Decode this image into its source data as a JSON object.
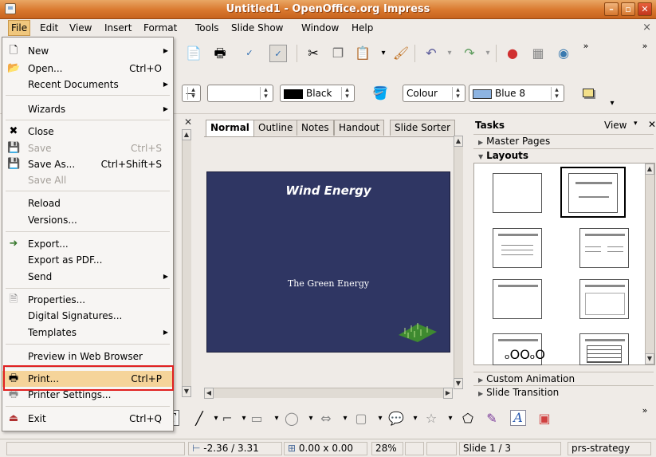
{
  "window": {
    "title": "Untitled1 - OpenOffice.org Impress"
  },
  "menubar": {
    "items": [
      "File",
      "Edit",
      "View",
      "Insert",
      "Format",
      "Tools",
      "Slide Show",
      "Window",
      "Help"
    ],
    "close_doc": "×"
  },
  "toolbar2": {
    "line_color": "Black",
    "fill_mode": "Colour",
    "fill_color": "Blue 8",
    "line_color_hex": "#000000",
    "fill_color_hex": "#8db4e2"
  },
  "doc": {
    "tabs": [
      "Normal",
      "Outline",
      "Notes",
      "Handout",
      "Slide Sorter"
    ],
    "slide_title": "Wind Energy",
    "slide_subtitle": "The Green Energy",
    "slide_bg": "#2f3663"
  },
  "tasks": {
    "title": "Tasks",
    "view": "View",
    "sections": [
      "Master Pages",
      "Layouts",
      "Custom Animation",
      "Slide Transition"
    ]
  },
  "statusbar": {
    "position": "-2.36 / 3.31",
    "size": "0.00 x 0.00",
    "zoom": "28%",
    "slide": "Slide 1 / 3",
    "master": "prs-strategy"
  },
  "filemenu": {
    "new": "New",
    "open": "Open...",
    "open_sc": "Ctrl+O",
    "recent": "Recent Documents",
    "wizards": "Wizards",
    "close": "Close",
    "save": "Save",
    "save_sc": "Ctrl+S",
    "save_as": "Save As...",
    "save_as_sc": "Ctrl+Shift+S",
    "save_all": "Save All",
    "reload": "Reload",
    "versions": "Versions...",
    "export": "Export...",
    "export_pdf": "Export as PDF...",
    "send": "Send",
    "properties": "Properties...",
    "digital_signatures": "Digital Signatures...",
    "templates": "Templates",
    "preview_web": "Preview in Web Browser",
    "print": "Print...",
    "print_sc": "Ctrl+P",
    "printer_settings": "Printer Settings...",
    "exit": "Exit",
    "exit_sc": "Ctrl+Q"
  }
}
